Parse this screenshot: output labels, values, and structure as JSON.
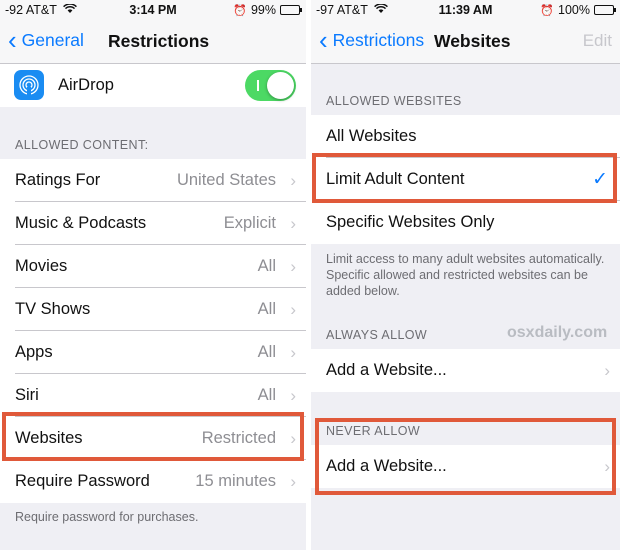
{
  "left": {
    "status": {
      "carrier": "-92 AT&T",
      "time": "3:14 PM",
      "battery": "99%",
      "battery_level": 0.99
    },
    "nav": {
      "back": "General",
      "title": "Restrictions"
    },
    "airdrop": {
      "label": "AirDrop",
      "toggle_on": true
    },
    "section_header": "ALLOWED CONTENT:",
    "items": [
      {
        "label": "Ratings For",
        "value": "United States"
      },
      {
        "label": "Music & Podcasts",
        "value": "Explicit"
      },
      {
        "label": "Movies",
        "value": "All"
      },
      {
        "label": "TV Shows",
        "value": "All"
      },
      {
        "label": "Apps",
        "value": "All"
      },
      {
        "label": "Siri",
        "value": "All"
      },
      {
        "label": "Websites",
        "value": "Restricted"
      },
      {
        "label": "Require Password",
        "value": "15 minutes"
      }
    ],
    "footer": "Require password for purchases."
  },
  "right": {
    "status": {
      "carrier": "-97 AT&T",
      "time": "11:39 AM",
      "battery": "100%",
      "battery_level": 1.0
    },
    "nav": {
      "back": "Restrictions",
      "title": "Websites",
      "edit": "Edit"
    },
    "allowed_header": "ALLOWED WEBSITES",
    "options": [
      {
        "label": "All Websites",
        "checked": false
      },
      {
        "label": "Limit Adult Content",
        "checked": true
      },
      {
        "label": "Specific Websites Only",
        "checked": false
      }
    ],
    "description": "Limit access to many adult websites automatically. Specific allowed and restricted websites can be added below.",
    "always_allow_header": "ALWAYS ALLOW",
    "always_allow_add": "Add a Website...",
    "never_allow_header": "NEVER ALLOW",
    "never_allow_add": "Add a Website..."
  },
  "watermark": "osxdaily.com",
  "icons": {
    "chevron": "›",
    "check": "✓",
    "back_chevron": "‹",
    "alarm": "⏰"
  },
  "colors": {
    "accent": "#0a7aff",
    "toggle_on": "#4cd964",
    "highlight": "#e0593a"
  }
}
